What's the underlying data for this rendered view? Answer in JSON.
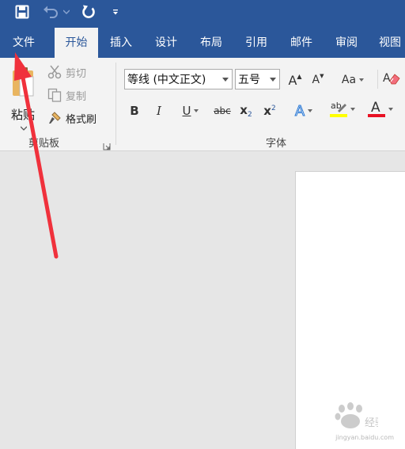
{
  "qat": {
    "save_icon": "save-icon",
    "undo_icon": "undo-icon",
    "redo_icon": "redo-icon",
    "customize_icon": "customize-qat-icon"
  },
  "tabs": [
    "文件",
    "开始",
    "插入",
    "设计",
    "布局",
    "引用",
    "邮件",
    "审阅",
    "视图"
  ],
  "active_tab": "开始",
  "clipboard": {
    "paste": "粘贴",
    "cut": "剪切",
    "copy": "复制",
    "format_painter": "格式刷",
    "group_label": "剪贴板"
  },
  "font": {
    "font_name": "等线 (中文正文)",
    "font_size": "五号",
    "grow": "A",
    "shrink": "A",
    "change_case": "Aa",
    "bold": "B",
    "italic": "I",
    "underline": "U",
    "strikethrough": "abc",
    "subscript": "x",
    "subscript_mark": "2",
    "superscript": "x",
    "superscript_mark": "2",
    "text_effects": "A",
    "highlight": "ab",
    "font_color": "A",
    "group_label": "字体"
  },
  "watermark": {
    "text": "jingyan.baidu.com"
  },
  "colors": {
    "brand": "#2b579a",
    "ribbon_bg": "#f3f3f3",
    "highlight": "#ffff00",
    "font_color": "#e81123",
    "arrow": "#f0313c",
    "canvas": "#e6e6e6"
  }
}
